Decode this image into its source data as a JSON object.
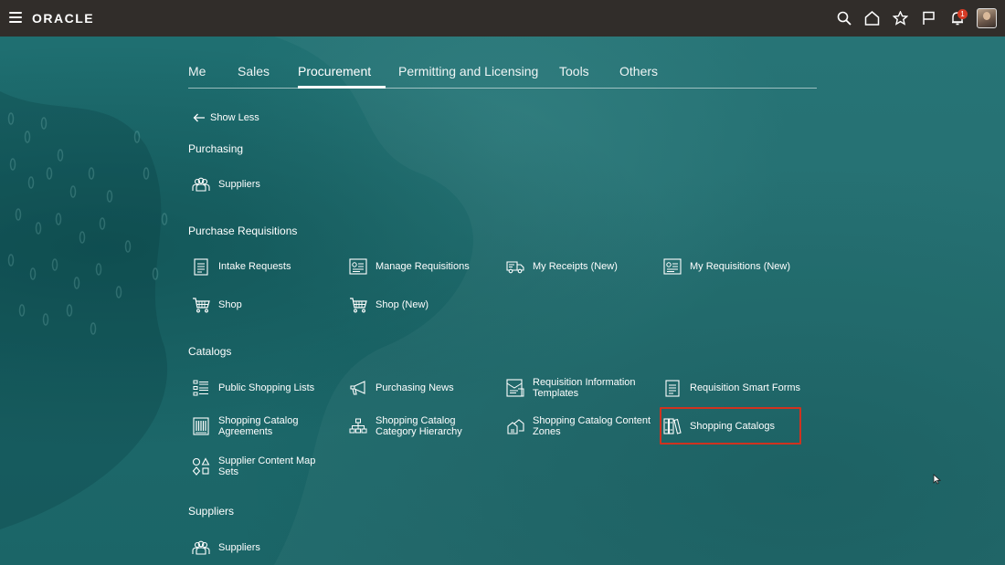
{
  "header": {
    "brand": "ORACLE",
    "notifications_count": "1"
  },
  "tabs": [
    {
      "label": "Me"
    },
    {
      "label": "Sales"
    },
    {
      "label": "Procurement",
      "active": true
    },
    {
      "label": "Permitting and Licensing"
    },
    {
      "label": "Tools"
    },
    {
      "label": "Others"
    }
  ],
  "show_less": "Show Less",
  "sections": {
    "purchasing": {
      "title": "Purchasing",
      "items": [
        {
          "label": "Suppliers",
          "icon": "suppliers-icon"
        }
      ]
    },
    "purchase_requisitions": {
      "title": "Purchase Requisitions",
      "items": [
        {
          "label": "Intake Requests",
          "icon": "document-icon"
        },
        {
          "label": "Manage Requisitions",
          "icon": "manage-list-icon"
        },
        {
          "label": "My Receipts (New)",
          "icon": "truck-icon"
        },
        {
          "label": "My Requisitions (New)",
          "icon": "manage-list-icon"
        },
        {
          "label": "Shop",
          "icon": "cart-icon"
        },
        {
          "label": "Shop (New)",
          "icon": "cart-icon"
        }
      ]
    },
    "catalogs": {
      "title": "Catalogs",
      "items": [
        {
          "label": "Public Shopping Lists",
          "icon": "list-icon"
        },
        {
          "label": "Purchasing News",
          "icon": "megaphone-icon"
        },
        {
          "label": "Requisition Information Templates",
          "icon": "template-icon"
        },
        {
          "label": "Requisition Smart Forms",
          "icon": "form-icon"
        },
        {
          "label": "Shopping Catalog Agreements",
          "icon": "agreement-icon"
        },
        {
          "label": "Shopping Catalog Category Hierarchy",
          "icon": "hierarchy-icon"
        },
        {
          "label": "Shopping Catalog Content Zones",
          "icon": "content-zones-icon"
        },
        {
          "label": "Shopping Catalogs",
          "icon": "catalogs-icon",
          "highlighted": true
        },
        {
          "label": "Supplier Content Map Sets",
          "icon": "map-sets-icon"
        }
      ]
    },
    "suppliers": {
      "title": "Suppliers",
      "items": [
        {
          "label": "Suppliers",
          "icon": "suppliers-icon"
        }
      ]
    }
  },
  "colors": {
    "topbar": "#312d2a",
    "background": "#1e6a6c",
    "highlight": "#d0321f",
    "badge": "#d63b25"
  }
}
